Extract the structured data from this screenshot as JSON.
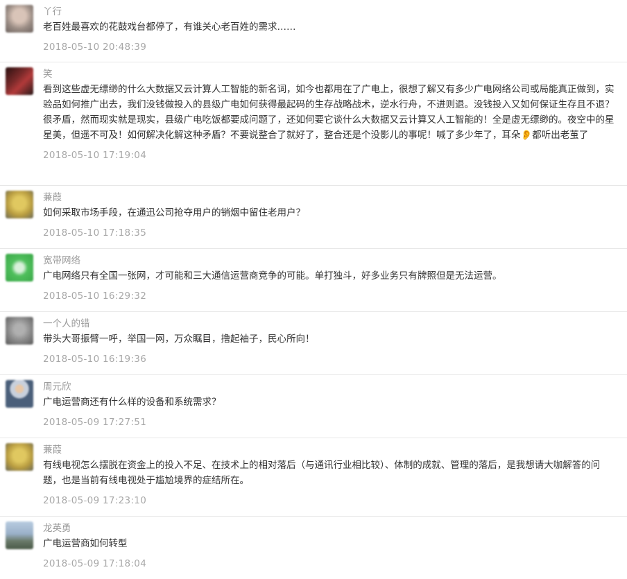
{
  "comments": [
    {
      "nickname": "丫行",
      "text": "老百姓最喜欢的花鼓戏台都停了，有谁关心老百姓的需求……",
      "time": "2018-05-10 20:48:39",
      "avatar_color": "#9a8c84",
      "avatar_icon": "blurred-portrait-avatar"
    },
    {
      "nickname": "笑",
      "text": "看到这些虚无缥缈的什么大数据又云计算人工智能的新名词，如今也都用在了广电上，很想了解又有多少广电网络公司或局能真正做到，实验品如何推广出去，我们没钱做投入的县级广电如何获得最起码的生存战略战术，逆水行舟，不进则退。没钱投入又如何保证生存且不退？很矛盾，然而现实就是现实，县级广电吃饭都要成问题了，还如何要它谈什么大数据又云计算又人工智能的！全是虚无缥缈的。夜空中的星星美，但遥不可及！如何解决化解这种矛盾？不要说整合了就好了，整合还是个没影儿的事呢！喊了多少年了，耳朵👂都听出老茧了",
      "time": "2018-05-10 17:19:04",
      "avatar_color": "#7a2a2a",
      "avatar_icon": "red-dark-avatar"
    },
    {
      "nickname": "蒹葭",
      "text": "如何采取市场手段，在通迅公司抢夺用户的销烟中留住老用户？",
      "time": "2018-05-10 17:18:35",
      "avatar_color": "#c9b455",
      "avatar_icon": "yellow-figure-avatar"
    },
    {
      "nickname": "宽带网络",
      "text": "广电网络只有全国一张网，才可能和三大通信运营商竞争的可能。单打独斗，好多业务只有牌照但是无法运营。",
      "time": "2018-05-10 16:29:32",
      "avatar_color": "#4fbf5c",
      "avatar_icon": "green-square-avatar"
    },
    {
      "nickname": "一个人的错",
      "text": "带头大哥振臂一呼，举国一网，万众瞩目，撸起袖子，民心所向！",
      "time": "2018-05-10 16:19:36",
      "avatar_color": "#8a8a8a",
      "avatar_icon": "gray-blurred-avatar"
    },
    {
      "nickname": "周元欣",
      "text": "广电运营商还有什么样的设备和系统需求？",
      "time": "2018-05-09 17:27:51",
      "avatar_color": "#4a5f7a",
      "avatar_icon": "person-portrait-avatar"
    },
    {
      "nickname": "蒹葭",
      "text": "有线电视怎么摆脱在资金上的投入不足、在技术上的相对落后（与通讯行业相比较）、体制的成就、管理的落后，是我想请大咖解答的问题，也是当前有线电视处于尴尬境界的症结所在。",
      "time": "2018-05-09 17:23:10",
      "avatar_color": "#c9b455",
      "avatar_icon": "yellow-figure-avatar"
    },
    {
      "nickname": "龙英勇",
      "text": "广电运营商如何转型",
      "time": "2018-05-09 17:18:04",
      "avatar_color": "#8aa0b8",
      "avatar_icon": "landscape-avatar"
    }
  ]
}
